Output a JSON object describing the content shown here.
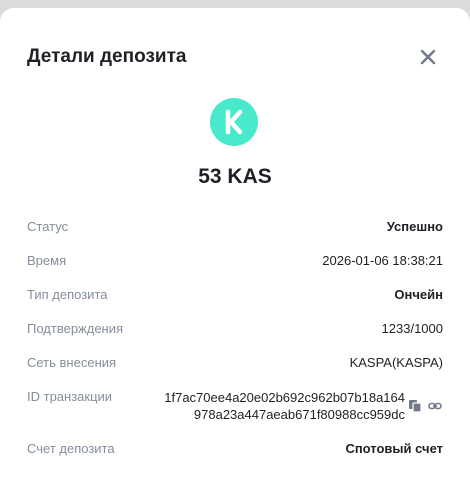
{
  "dialog": {
    "title": "Детали депозита",
    "amount": "53 KAS",
    "coin_icon": "kaspa-logo-icon",
    "accent_color": "#49eacb"
  },
  "details": {
    "status": {
      "label": "Статус",
      "value": "Успешно"
    },
    "time": {
      "label": "Время",
      "value": "2026-01-06 18:38:21"
    },
    "deposit_type": {
      "label": "Тип депозита",
      "value": "Ончейн"
    },
    "confirmations": {
      "label": "Подтверждения",
      "value": "1233/1000"
    },
    "network": {
      "label": "Сеть внесения",
      "value": "KASPA(KASPA)"
    },
    "tx_id": {
      "label": "ID транзакции",
      "value_line1": "1f7ac70ee4a20e02b692c962b07b18a164",
      "value_line2": "978a23a447aeab671f80988cc959dc"
    },
    "deposit_account": {
      "label": "Счет депозита",
      "value": "Спотовый счет"
    }
  }
}
